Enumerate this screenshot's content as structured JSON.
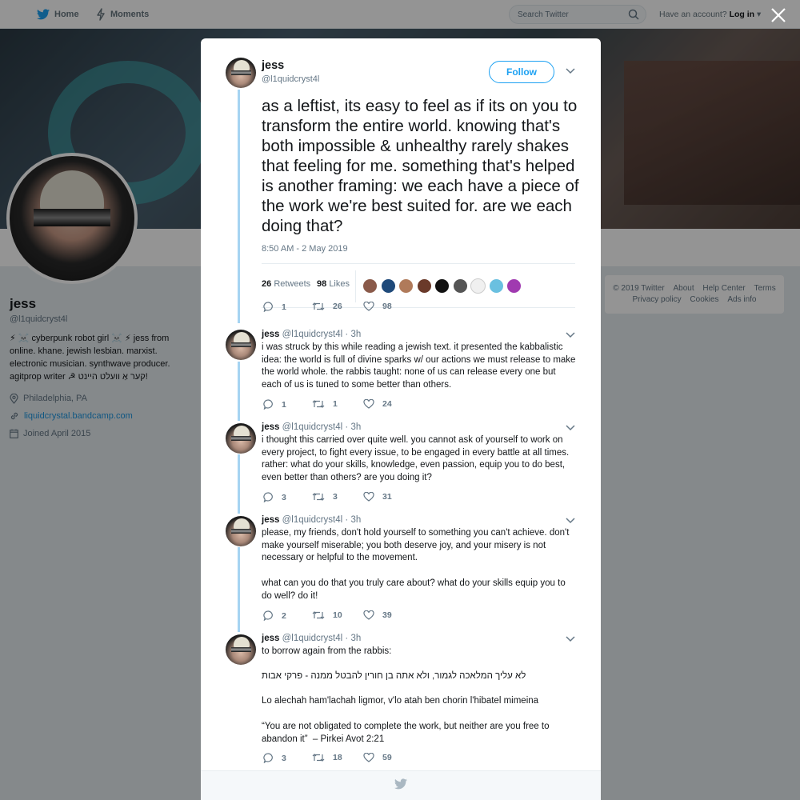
{
  "topbar": {
    "home_label": "Home",
    "moments_label": "Moments",
    "search_placeholder": "Search Twitter",
    "account_prompt": "Have an account?",
    "login_label": "Log in"
  },
  "profile": {
    "name": "jess",
    "handle": "@l1quidcryst4l",
    "bio": "⚡ ☠️ cyberpunk robot girl ☠️ ⚡ jess from online. khane. jewish lesbian. marxist. electronic musician. synthwave producer. agitprop writer ☭ קער אַ וועלט היינט!",
    "location": "Philadelphia, PA",
    "website": "liquidcrystal.bandcamp.com",
    "joined": "Joined April 2015"
  },
  "footer": {
    "links": [
      "© 2019 Twitter",
      "About",
      "Help Center",
      "Terms",
      "Privacy policy",
      "Cookies",
      "Ads info"
    ]
  },
  "modal": {
    "main_tweet": {
      "name": "jess",
      "handle": "@l1quidcryst4l",
      "follow_label": "Follow",
      "text": "as a leftist, its easy to feel as if its on you to transform the entire world. knowing that's both impossible & unhealthy rarely shakes that feeling for me. something that's helped is another framing: we each have a piece of the work we're best suited for. are we each doing that?",
      "timestamp": "8:50 AM - 2 May 2019",
      "retweets_count": "26",
      "retweets_label": "Retweets",
      "likes_count": "98",
      "likes_label": "Likes",
      "likers": [
        "#8a5a4a",
        "#1f4a7a",
        "#b07a5a",
        "#6a3a2a",
        "#111111",
        "#555555",
        "#f0f0f0",
        "#6ac0e0",
        "#a03ab0"
      ],
      "replies": "1",
      "retweets": "26",
      "likes": "98"
    },
    "replies": [
      {
        "name": "jess",
        "handle": "@l1quidcryst4l",
        "time": "3h",
        "text": "i was struck by this while reading a jewish text. it presented the kabbalistic idea: the world is full of divine sparks w/ our actions we must release to make the world whole. the rabbis taught: none of us can release every one but each of us is tuned to some better than others.",
        "replies": "1",
        "retweets": "1",
        "likes": "24"
      },
      {
        "name": "jess",
        "handle": "@l1quidcryst4l",
        "time": "3h",
        "text": "i thought this carried over quite well. you cannot ask of yourself to work on every project, to fight every issue, to be engaged in every battle at all times. rather: what do your skills, knowledge, even passion, equip you to do best, even better than others? are you doing it?",
        "replies": "3",
        "retweets": "3",
        "likes": "31"
      },
      {
        "name": "jess",
        "handle": "@l1quidcryst4l",
        "time": "3h",
        "text_1": "please, my friends, don't hold yourself to something you can't achieve. don't make yourself miserable; you both deserve joy, and your misery is not necessary or helpful to the movement.",
        "text_2": "what can you do that you truly care about? what do your skills equip you to do well? do it!",
        "replies": "2",
        "retweets": "10",
        "likes": "39"
      },
      {
        "name": "jess",
        "handle": "@l1quidcryst4l",
        "time": "3h",
        "text_1": "to borrow again from the rabbis:",
        "text_hebrew": "לא עליך המלאכה לגמור, ולא אתה בן חורין להבטל ממנה - פרקי אבות",
        "text_translit": "Lo alechah ham'lachah ligmor, v'lo atah ben chorin l'hibatel mimeina",
        "text_quote": "“You are not obligated to complete the work, but neither are you free to abandon it”  – Pirkei Avot 2:21",
        "replies": "3",
        "retweets": "18",
        "likes": "59"
      }
    ]
  },
  "colors": {
    "accent": "#1da1f2",
    "thread_line": "#a6d4f2",
    "muted": "#657786"
  },
  "icons": [
    "twitter-bird-icon",
    "moments-icon",
    "search-icon",
    "close-icon",
    "chevron-down-icon",
    "reply-icon",
    "retweet-icon",
    "heart-icon",
    "location-icon",
    "link-icon",
    "calendar-icon"
  ]
}
